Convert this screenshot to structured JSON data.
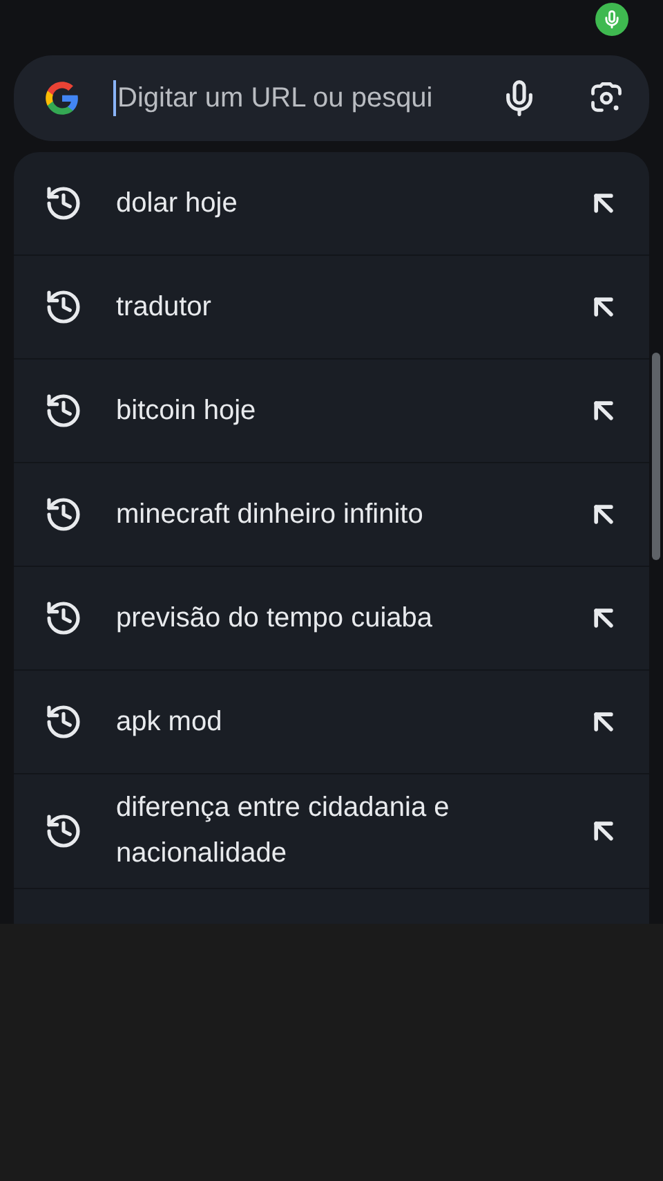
{
  "search": {
    "placeholder": "Digitar um URL ou pesqui"
  },
  "suggestions": [
    {
      "text": "dolar hoje"
    },
    {
      "text": "tradutor"
    },
    {
      "text": "bitcoin hoje"
    },
    {
      "text": "minecraft dinheiro infinito"
    },
    {
      "text": "previsão do tempo cuiaba"
    },
    {
      "text": "apk mod"
    },
    {
      "text": "diferença entre cidadania e nacionalidade"
    }
  ]
}
